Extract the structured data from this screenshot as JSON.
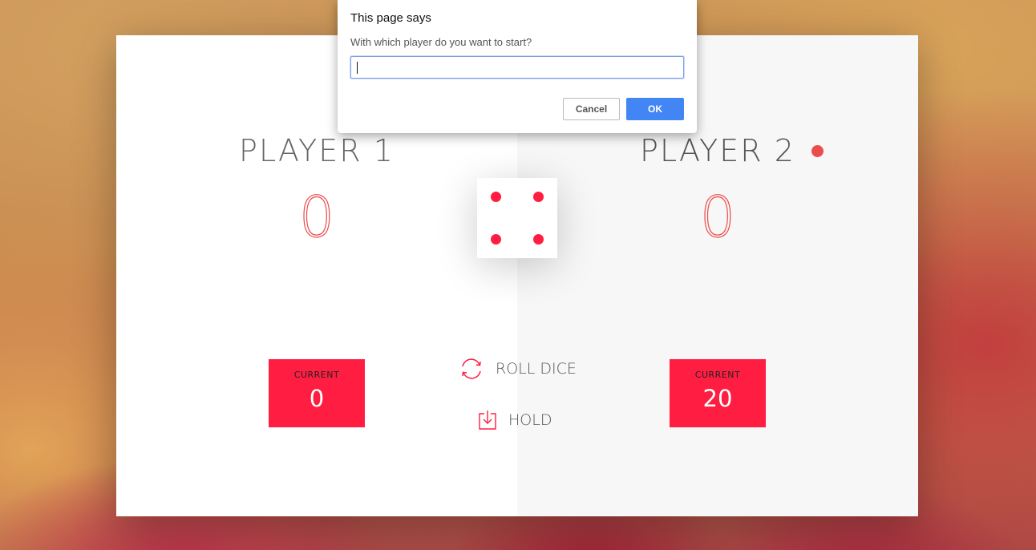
{
  "players": [
    {
      "name": "Player 1",
      "score": "0",
      "current_label": "Current",
      "current_score": "0",
      "active": false
    },
    {
      "name": "Player 2",
      "score": "0",
      "current_label": "Current",
      "current_score": "20",
      "active": true
    }
  ],
  "dice": {
    "value": 4
  },
  "controls": {
    "roll_label": "Roll dice",
    "roll_icon": "refresh-icon",
    "hold_label": "Hold",
    "hold_icon": "download-icon"
  },
  "dialog": {
    "title": "This page says",
    "message": "With which player do you want to start?",
    "input_value": "",
    "cancel_label": "Cancel",
    "ok_label": "OK"
  },
  "colors": {
    "accent": "#ff1e42",
    "score": "#eb4d4d",
    "dialog_ok": "#4285f4"
  }
}
